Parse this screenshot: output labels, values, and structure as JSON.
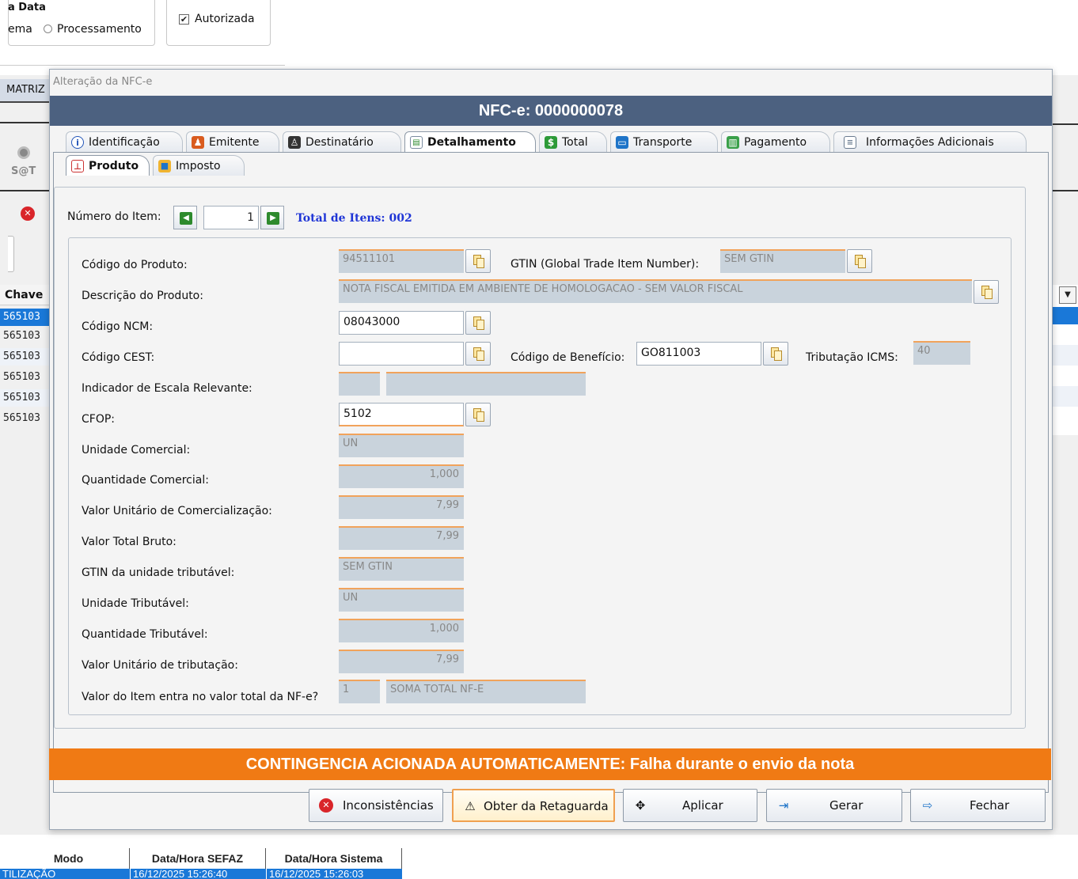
{
  "background": {
    "top_left_label": "a Data",
    "radio_left_label": "ema",
    "radio_processamento": "Processamento",
    "check_autorizada": "Autorizada",
    "tab_matriz": "MATRIZ",
    "sat_label": "S@T",
    "list_header": "Chave",
    "list_rows": [
      "565103",
      "565103",
      "565103",
      "565103",
      "565103",
      "565103"
    ],
    "bottom_columns": [
      "Modo",
      "Data/Hora SEFAZ",
      "Data/Hora Sistema"
    ],
    "bottom_row": [
      "TILIZAÇÃO",
      "16/12/2025 15:26:40",
      "16/12/2025 15:26:03"
    ]
  },
  "dialog": {
    "window_title": "Alteração da NFC-e",
    "header": "NFC-e: 0000000078",
    "tabs": [
      {
        "label": "Identificação",
        "icon": "info-icon"
      },
      {
        "label": "Emitente",
        "icon": "users-icon"
      },
      {
        "label": "Destinatário",
        "icon": "user-icon"
      },
      {
        "label": "Detalhamento",
        "icon": "document-icon",
        "active": true
      },
      {
        "label": "Total",
        "icon": "money-icon"
      },
      {
        "label": "Transporte",
        "icon": "bus-icon"
      },
      {
        "label": "Pagamento",
        "icon": "cash-icon"
      },
      {
        "label": "Informações Adicionais",
        "icon": "note-icon"
      }
    ],
    "subtabs": [
      {
        "label": "Produto",
        "icon": "product-icon",
        "active": true
      },
      {
        "label": "Imposto",
        "icon": "folder-icon"
      }
    ],
    "item_nav": {
      "label": "Número do Item:",
      "value": "1",
      "total": "Total de Itens: 002"
    },
    "fields": {
      "codigo_produto": {
        "label": "Código do Produto:",
        "value": "94511101"
      },
      "gtin": {
        "label": "GTIN (Global Trade Item Number):",
        "value": "SEM GTIN"
      },
      "descricao": {
        "label": "Descrição do Produto:",
        "value": "NOTA FISCAL EMITIDA EM AMBIENTE DE HOMOLOGACAO - SEM VALOR FISCAL"
      },
      "ncm": {
        "label": "Código NCM:",
        "value": "08043000"
      },
      "cest": {
        "label": "Código CEST:",
        "value": ""
      },
      "beneficio": {
        "label": "Código de Benefício:",
        "value": "GO811003"
      },
      "trib_icms": {
        "label": "Tributação ICMS:",
        "value": "40"
      },
      "escala": {
        "label": "Indicador de Escala Relevante:",
        "value1": "",
        "value2": ""
      },
      "cfop": {
        "label": "CFOP:",
        "value": "5102"
      },
      "unid_com": {
        "label": "Unidade Comercial:",
        "value": "UN"
      },
      "qtd_com": {
        "label": "Quantidade Comercial:",
        "value": "1,000"
      },
      "vl_unit_com": {
        "label": "Valor Unitário de Comercialização:",
        "value": "7,99"
      },
      "vl_total": {
        "label": "Valor Total Bruto:",
        "value": "7,99"
      },
      "gtin_trib": {
        "label": "GTIN da unidade tributável:",
        "value": "SEM GTIN"
      },
      "unid_trib": {
        "label": "Unidade Tributável:",
        "value": "UN"
      },
      "qtd_trib": {
        "label": "Quantidade Tributável:",
        "value": "1,000"
      },
      "vl_unit_trib": {
        "label": "Valor Unitário de tributação:",
        "value": "7,99"
      },
      "ind_tot": {
        "label": "Valor do Item entra no valor total da NF-e?",
        "value1": "1",
        "value2": "SOMA TOTAL NF-E"
      }
    },
    "banner": "CONTINGENCIA ACIONADA AUTOMATICAMENTE: Falha durante o envio da nota",
    "buttons": {
      "inconsistencias": "Inconsistências",
      "obter": "Obter da Retaguarda",
      "aplicar": "Aplicar",
      "gerar": "Gerar",
      "fechar": "Fechar"
    }
  }
}
